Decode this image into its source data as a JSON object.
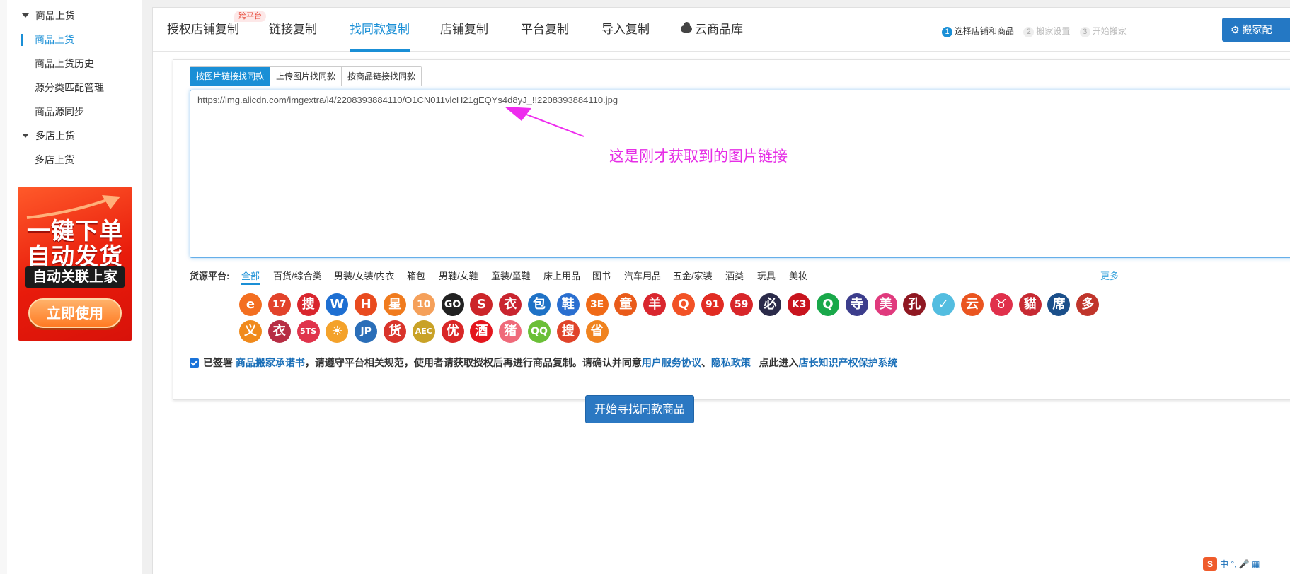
{
  "sidebar": {
    "group1": "商品上货",
    "items1": [
      "商品上货",
      "商品上货历史",
      "源分类匹配管理",
      "商品源同步"
    ],
    "group2": "多店上货",
    "items2": [
      "多店上货"
    ],
    "promo": {
      "line1": "一键下单",
      "line2": "自动发货",
      "line3": "自动关联上家",
      "button": "立即使用"
    }
  },
  "tabs": [
    {
      "label": "授权店铺复制",
      "badge": "跨平台"
    },
    {
      "label": "链接复制"
    },
    {
      "label": "找同款复制",
      "active": true
    },
    {
      "label": "店铺复制"
    },
    {
      "label": "平台复制"
    },
    {
      "label": "导入复制"
    },
    {
      "label": "云商品库"
    }
  ],
  "steps": [
    {
      "num": "1",
      "label": "选择店铺和商品"
    },
    {
      "num": "2",
      "label": "搬家设置"
    },
    {
      "num": "3",
      "label": "开始搬家"
    }
  ],
  "config_button": "搬家配",
  "subtabs": [
    "按图片链接找同款",
    "上传图片找同款",
    "按商品链接找同款"
  ],
  "url_value": "https://img.alicdn.com/imgextra/i4/2208393884110/O1CN011vlcH21gEQYs4d8yJ_!!2208393884110.jpg",
  "annotation": "这是刚才获取到的图片链接",
  "source": {
    "label": "货源平台:",
    "categories": [
      "全部",
      "百货/综合类",
      "男装/女装/内衣",
      "箱包",
      "男鞋/女鞋",
      "童装/童鞋",
      "床上用品",
      "图书",
      "汽车用品",
      "五金/家装",
      "酒类",
      "玩具",
      "美妆"
    ],
    "more": "更多",
    "logos_row1": [
      {
        "t": "e",
        "c": "#f36f21"
      },
      {
        "t": "17",
        "c": "#e2432b"
      },
      {
        "t": "搜",
        "c": "#d9262e"
      },
      {
        "t": "W",
        "c": "#1e6fd2"
      },
      {
        "t": "H",
        "c": "#e94b1f"
      },
      {
        "t": "星",
        "c": "#f07b1e"
      },
      {
        "t": "10",
        "c": "#f5a05a"
      },
      {
        "t": "GO",
        "c": "#222222"
      },
      {
        "t": "S",
        "c": "#cc2529"
      },
      {
        "t": "衣",
        "c": "#c9252f"
      },
      {
        "t": "包",
        "c": "#1f72c6"
      },
      {
        "t": "鞋",
        "c": "#2a6fd0"
      },
      {
        "t": "3E",
        "c": "#f06a17"
      },
      {
        "t": "童",
        "c": "#e95b1a"
      },
      {
        "t": "羊",
        "c": "#d9262e"
      },
      {
        "t": "Q",
        "c": "#f25226"
      },
      {
        "t": "91",
        "c": "#e12b22"
      },
      {
        "t": "59",
        "c": "#d8262a"
      },
      {
        "t": "必",
        "c": "#2b2b4a"
      },
      {
        "t": "K3",
        "c": "#c8141e"
      },
      {
        "t": "Q",
        "c": "#19a84a"
      },
      {
        "t": "寺",
        "c": "#3c3d8c"
      },
      {
        "t": "美",
        "c": "#e03a7d"
      },
      {
        "t": "孔",
        "c": "#8f1822"
      },
      {
        "t": "✓",
        "c": "#53bde0"
      },
      {
        "t": "云",
        "c": "#ea5520"
      },
      {
        "t": "♉",
        "c": "#e0304b"
      },
      {
        "t": "貓",
        "c": "#c72a33"
      },
      {
        "t": "席",
        "c": "#1b4f8a"
      },
      {
        "t": "多",
        "c": "#c0352b"
      }
    ],
    "logos_row2": [
      {
        "t": "义",
        "c": "#f08a1c"
      },
      {
        "t": "衣",
        "c": "#b72d44"
      },
      {
        "t": "5TS",
        "c": "#e0344c"
      },
      {
        "t": "☀",
        "c": "#f4a22b"
      },
      {
        "t": "JP",
        "c": "#2a6eb8"
      },
      {
        "t": "货",
        "c": "#d9342b"
      },
      {
        "t": "AEC",
        "c": "#c9a227"
      },
      {
        "t": "优",
        "c": "#d92727"
      },
      {
        "t": "酒",
        "c": "#e4161e"
      },
      {
        "t": "猪",
        "c": "#ef6a7a"
      },
      {
        "t": "QQ",
        "c": "#6bbf37"
      },
      {
        "t": "搜",
        "c": "#e0442a"
      },
      {
        "t": "省",
        "c": "#f0831f"
      }
    ]
  },
  "agreement": {
    "prefix": "已签署 ",
    "link1": "商品搬家承诺书",
    "middle": "，请遵守平台相关规范，使用者请获取授权后再进行商品复制。请确认并同意",
    "link2": "用户服务协议",
    "sep": "、",
    "link3": "隐私政策",
    "mid2": "   点此进入",
    "link4": "店长知识产权保护系统"
  },
  "start_button": "开始寻找同款商品",
  "ime": "中 °, 🎤 ▦"
}
